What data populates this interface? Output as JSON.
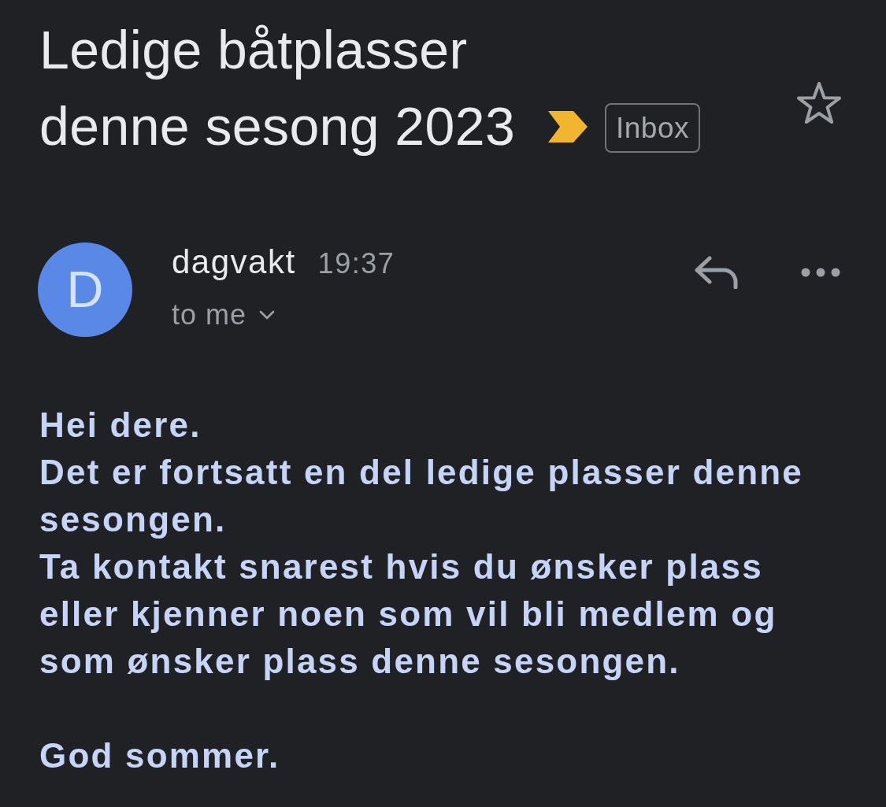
{
  "subject": {
    "title": "Ledige båtplasser denne sesong 2023",
    "important": true,
    "label": "Inbox",
    "starred": false
  },
  "message": {
    "avatar_letter": "D",
    "sender": "dagvakt",
    "time": "19:37",
    "recipient": "to me"
  },
  "body": {
    "paragraphs": [
      [
        "Hei dere.",
        "Det er fortsatt en del ledige plasser denne sesongen.",
        "Ta kontakt snarest hvis du ønsker plass eller kjenner noen som vil bli medlem og som ønsker plass denne sesongen."
      ],
      [
        "God sommer."
      ]
    ]
  }
}
